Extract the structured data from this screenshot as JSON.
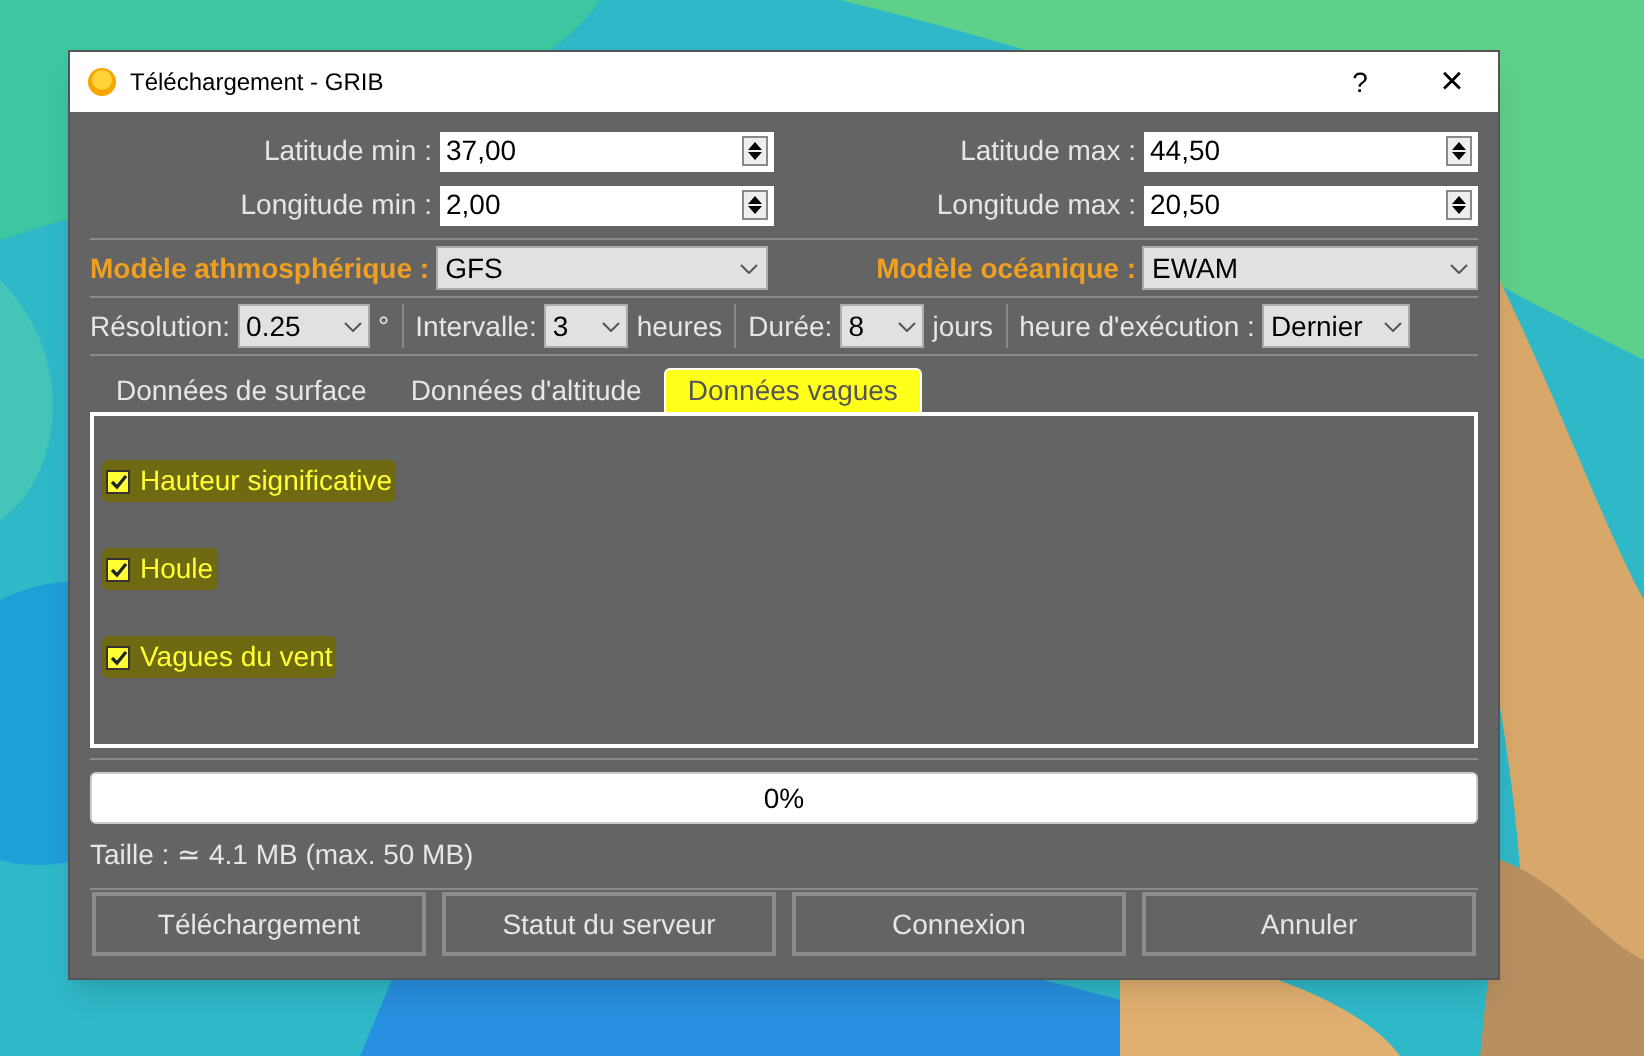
{
  "window": {
    "title": "Téléchargement - GRIB",
    "help": "?",
    "close": "×"
  },
  "bounds": [
    {
      "label": "Latitude min :",
      "value": "37,00"
    },
    {
      "label": "Latitude max :",
      "value": "44,50"
    },
    {
      "label": "Longitude min :",
      "value": "2,00"
    },
    {
      "label": "Longitude max :",
      "value": "20,50"
    }
  ],
  "models": [
    {
      "label": "Modèle athmosphérique :",
      "value": "GFS"
    },
    {
      "label": "Modèle océanique :",
      "value": "EWAM"
    }
  ],
  "options": [
    {
      "label": "Résolution:",
      "value": "0.25",
      "unit": "°"
    },
    {
      "label": "Intervalle:",
      "value": "3",
      "unit": "heures"
    },
    {
      "label": "Durée:",
      "value": "8",
      "unit": "jours"
    },
    {
      "label": "heure d'exécution :",
      "value": "Dernier"
    }
  ],
  "tabs": [
    {
      "label": "Données de surface",
      "selected": false,
      "highlighted": false
    },
    {
      "label": "Données d'altitude",
      "selected": false,
      "highlighted": false
    },
    {
      "label": "Données vagues",
      "selected": true,
      "highlighted": true
    }
  ],
  "checkboxes": [
    {
      "label": "Hauteur significative",
      "checked": true,
      "highlighted": true
    },
    {
      "label": "Houle",
      "checked": true,
      "highlighted": true
    },
    {
      "label": "Vagues du vent",
      "checked": true,
      "highlighted": true
    }
  ],
  "progress": {
    "level": 0,
    "text": "0%"
  },
  "size_info": "Taille : ≃ 4.1 MB (max. 50 MB)",
  "buttons": [
    "Téléchargement",
    "Statut du serveur",
    "Connexion",
    "Annuler"
  ]
}
